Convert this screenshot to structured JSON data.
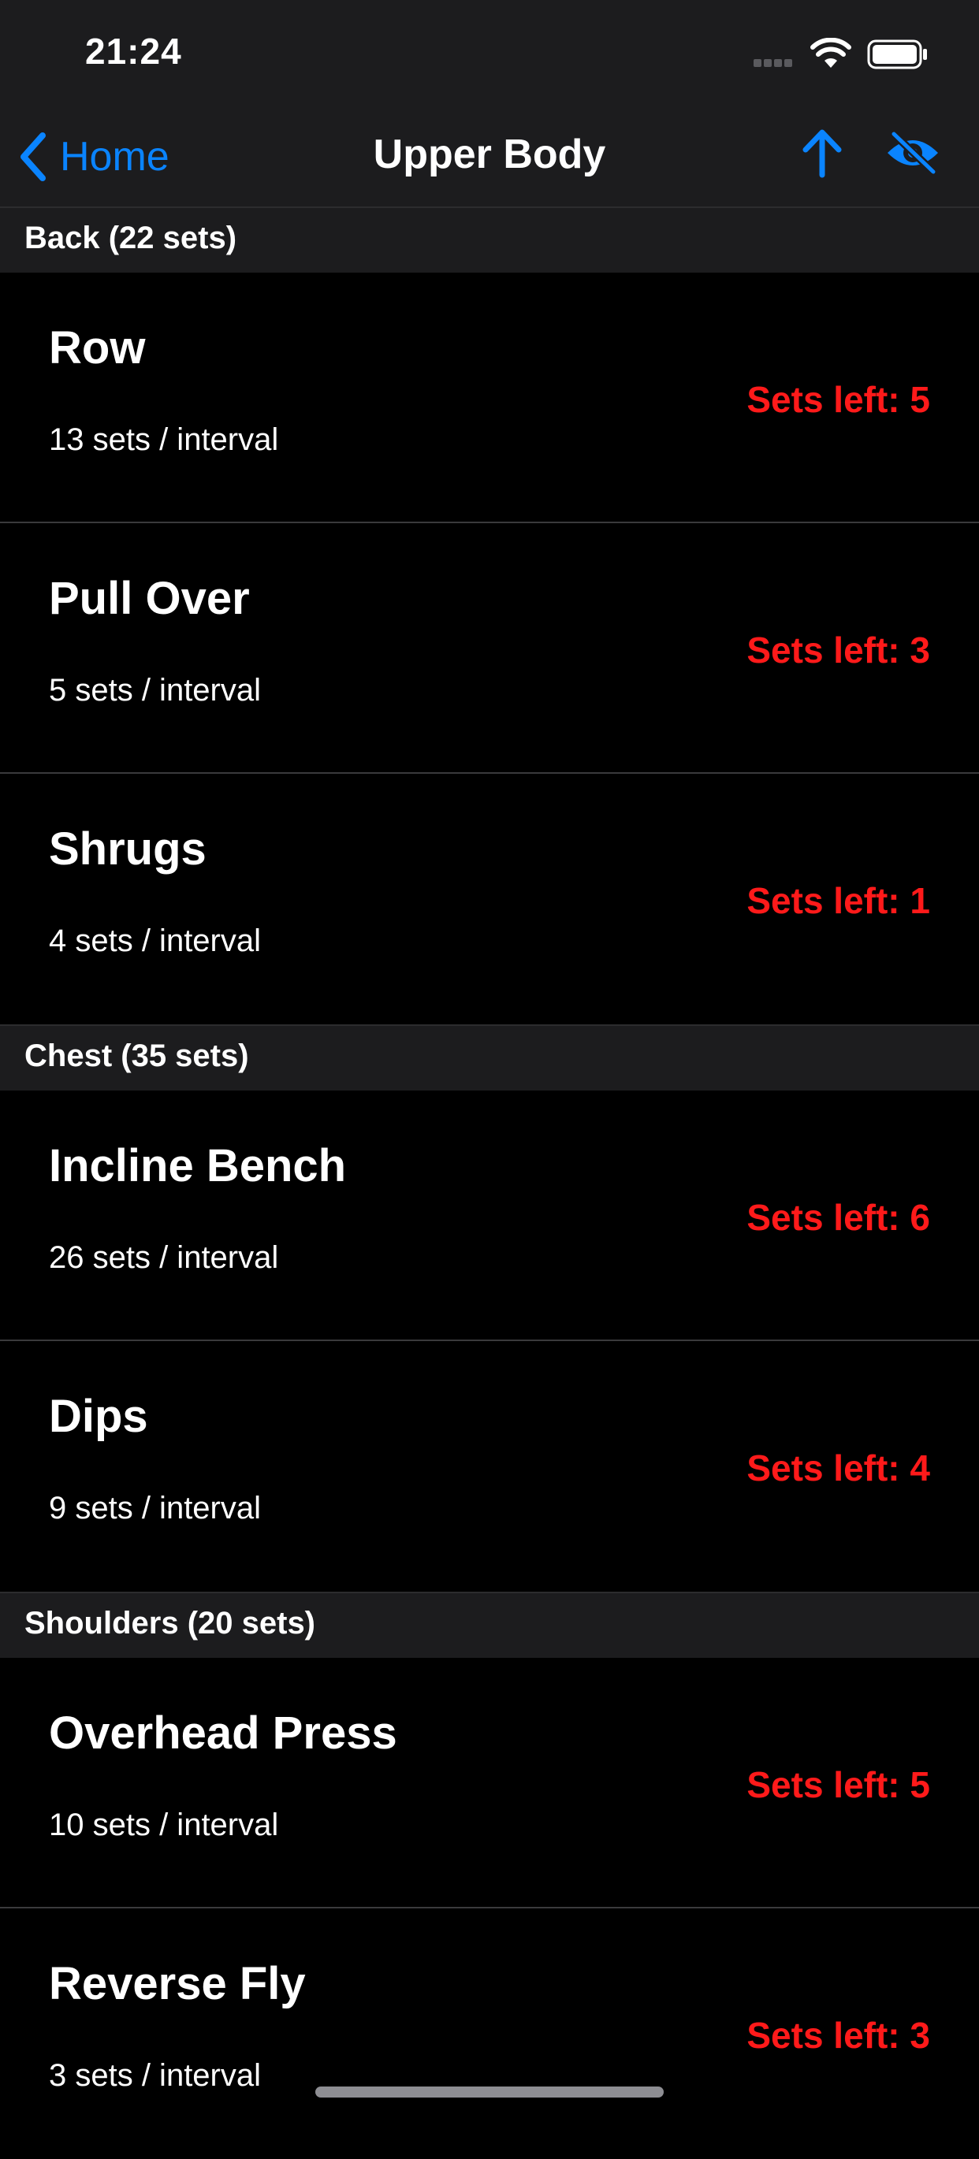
{
  "status_bar": {
    "time": "21:24"
  },
  "nav": {
    "back_label": "Home",
    "title": "Upper Body"
  },
  "sections": [
    {
      "header": "Back (22 sets)",
      "rows": [
        {
          "name": "Row",
          "interval": "13 sets / interval",
          "sets_left": "Sets left: 5"
        },
        {
          "name": "Pull Over",
          "interval": "5 sets / interval",
          "sets_left": "Sets left: 3"
        },
        {
          "name": "Shrugs",
          "interval": "4 sets / interval",
          "sets_left": "Sets left: 1"
        }
      ]
    },
    {
      "header": "Chest (35 sets)",
      "rows": [
        {
          "name": "Incline Bench",
          "interval": "26 sets / interval",
          "sets_left": "Sets left: 6"
        },
        {
          "name": "Dips",
          "interval": "9 sets / interval",
          "sets_left": "Sets left: 4"
        }
      ]
    },
    {
      "header": "Shoulders (20 sets)",
      "rows": [
        {
          "name": "Overhead Press",
          "interval": "10 sets / interval",
          "sets_left": "Sets left: 5"
        },
        {
          "name": "Reverse Fly",
          "interval": "3 sets / interval",
          "sets_left": "Sets left: 3"
        }
      ]
    }
  ],
  "colors": {
    "accent": "#0a84ff",
    "warning": "#ff1a1a",
    "bar_background": "#1c1c1e"
  },
  "icons": [
    "back-chevron-icon",
    "arrow-up-icon",
    "eye-slash-icon",
    "wifi-icon",
    "battery-icon"
  ]
}
